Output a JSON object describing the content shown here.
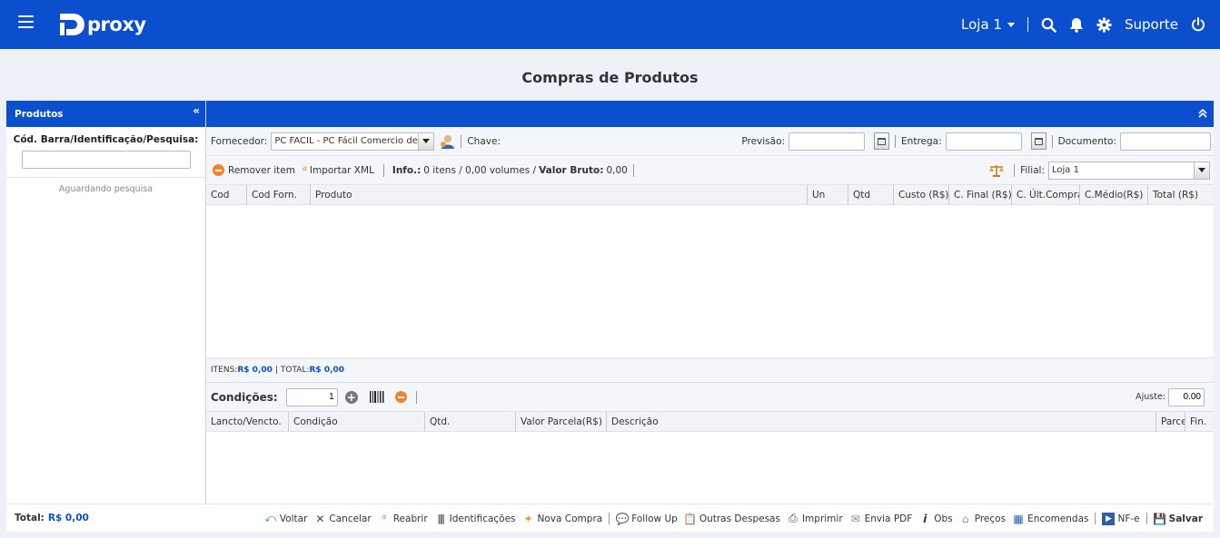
{
  "header": {
    "logo_text": "proxy",
    "store": "Loja 1",
    "support": "Suporte"
  },
  "page": {
    "title": "Compras de Produtos"
  },
  "left": {
    "panel_title": "Produtos",
    "search_label": "Cód. Barra/Identificação/Pesquisa:",
    "search_value": "",
    "status": "Aguardando pesquisa",
    "total_label": "Total:",
    "total_value": "R$ 0,00"
  },
  "form": {
    "supplier_label": "Fornecedor:",
    "supplier_value": "PC FACIL - PC Fácil Comercio de",
    "key_label": "Chave:",
    "forecast_label": "Previsão:",
    "delivery_label": "Entrega:",
    "document_label": "Documento:"
  },
  "toolbar": {
    "remove_item": "Remover item",
    "import_xml": "Importar XML",
    "info_label": "Info.:",
    "info_value": "0 itens / 0,00 volumes /",
    "gross_label": "Valor Bruto:",
    "gross_value": "0,00",
    "branch_label": "Filial:",
    "branch_value": "Loja 1"
  },
  "items_table": {
    "columns": [
      "Cod",
      "Cod Forn.",
      "Produto",
      "Un",
      "Qtd",
      "Custo (R$)",
      "C. Final (R$)",
      "C. Últ.Compra",
      "C.Médio(R$)",
      "Total (R$)"
    ]
  },
  "summary": {
    "items_label": "ITENS:",
    "items_value": "R$ 0,00",
    "total_label": "TOTAL:",
    "total_value": "R$ 0,00"
  },
  "conditions": {
    "label": "Condições:",
    "count": "1",
    "adjust_label": "Ajuste:",
    "adjust_value": "0.00",
    "columns": [
      "Lancto/Vencto.",
      "Condição",
      "Qtd.",
      "Valor Parcela(R$)",
      "Descrição",
      "Parce",
      "Fin."
    ]
  },
  "actions": {
    "back": "Voltar",
    "cancel": "Cancelar",
    "reopen": "Reabrir",
    "identifications": "Identificações",
    "new_purchase": "Nova Compra",
    "follow_up": "Follow Up",
    "other_expenses": "Outras Despesas",
    "print": "Imprimir",
    "send_pdf": "Envia PDF",
    "obs": "Obs",
    "prices": "Preços",
    "orders": "Encomendas",
    "nfe": "NF-e",
    "save": "Salvar"
  },
  "colors": {
    "brand": "#0b4fce",
    "accent_orange": "#f0842c"
  }
}
